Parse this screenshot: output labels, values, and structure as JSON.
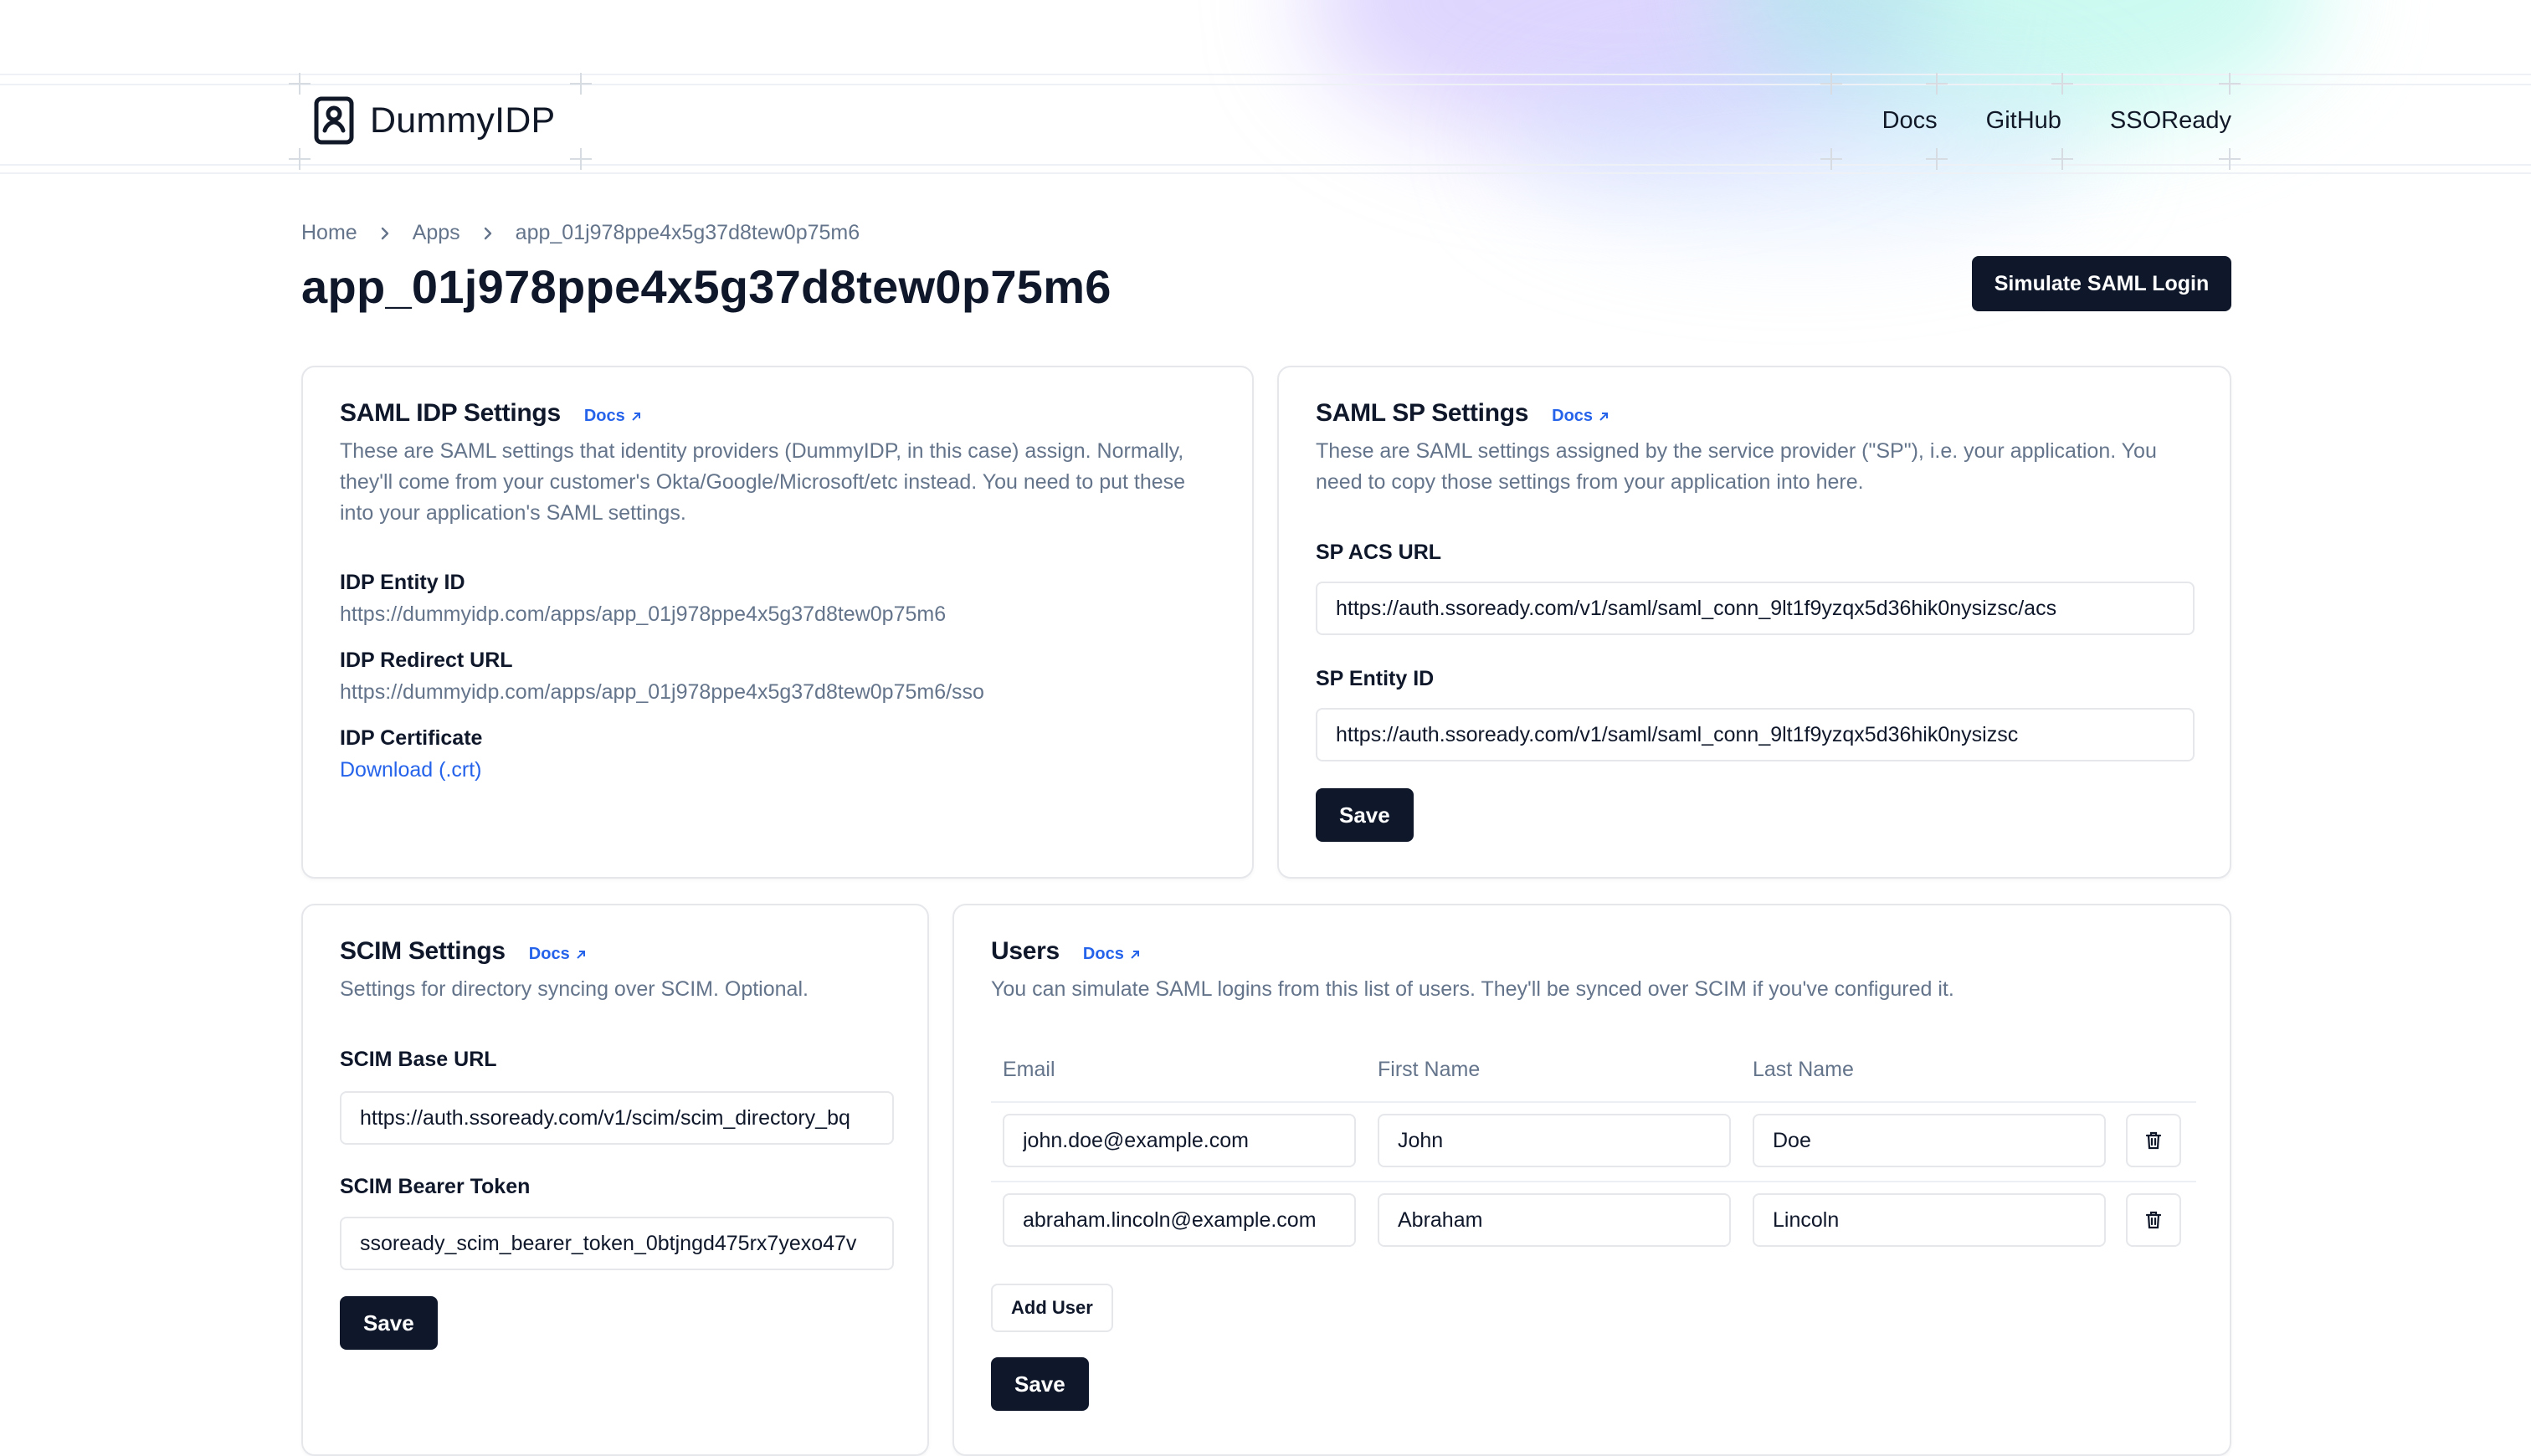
{
  "header": {
    "logo_text": "DummyIDP",
    "nav": [
      "Docs",
      "GitHub",
      "SSOReady"
    ]
  },
  "breadcrumb": [
    "Home",
    "Apps",
    "app_01j978ppe4x5g37d8tew0p75m6"
  ],
  "page_title": "app_01j978ppe4x5g37d8tew0p75m6",
  "simulate_button": "Simulate SAML Login",
  "idp_card": {
    "title": "SAML IDP Settings",
    "docs": "Docs",
    "description": "These are SAML settings that identity providers (DummyIDP, in this case) assign. Normally, they'll come from your customer's Okta/Google/Microsoft/etc instead. You need to put these into your application's SAML settings.",
    "entity_id_label": "IDP Entity ID",
    "entity_id_value": "https://dummyidp.com/apps/app_01j978ppe4x5g37d8tew0p75m6",
    "redirect_label": "IDP Redirect URL",
    "redirect_value": "https://dummyidp.com/apps/app_01j978ppe4x5g37d8tew0p75m6/sso",
    "cert_label": "IDP Certificate",
    "cert_link": "Download (.crt)"
  },
  "sp_card": {
    "title": "SAML SP Settings",
    "docs": "Docs",
    "description": "These are SAML settings assigned by the service provider (\"SP\"), i.e. your application. You need to copy those settings from your application into here.",
    "acs_label": "SP ACS URL",
    "acs_value": "https://auth.ssoready.com/v1/saml/saml_conn_9lt1f9yzqx5d36hik0nysizsc/acs",
    "entity_label": "SP Entity ID",
    "entity_value": "https://auth.ssoready.com/v1/saml/saml_conn_9lt1f9yzqx5d36hik0nysizsc",
    "save": "Save"
  },
  "scim_card": {
    "title": "SCIM Settings",
    "docs": "Docs",
    "description": "Settings for directory syncing over SCIM. Optional.",
    "base_url_label": "SCIM Base URL",
    "base_url_value": "https://auth.ssoready.com/v1/scim/scim_directory_bq",
    "token_label": "SCIM Bearer Token",
    "token_value": "ssoready_scim_bearer_token_0btjngd475rx7yexo47v",
    "save": "Save"
  },
  "users_card": {
    "title": "Users",
    "docs": "Docs",
    "description": "You can simulate SAML logins from this list of users. They'll be synced over SCIM if you've configured it.",
    "columns": [
      "Email",
      "First Name",
      "Last Name"
    ],
    "rows": [
      {
        "email": "john.doe@example.com",
        "first": "John",
        "last": "Doe"
      },
      {
        "email": "abraham.lincoln@example.com",
        "first": "Abraham",
        "last": "Lincoln"
      }
    ],
    "add_user": "Add User",
    "save": "Save"
  },
  "colors": {
    "primary": "#0f172a",
    "link": "#2563eb",
    "muted": "#64748b",
    "border": "#e5e7eb"
  }
}
